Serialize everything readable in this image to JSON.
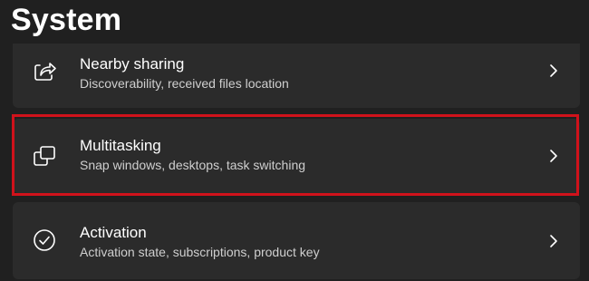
{
  "header": {
    "title": "System"
  },
  "settings": {
    "items": [
      {
        "title": "Nearby sharing",
        "subtitle": "Discoverability, received files location",
        "icon": "share-icon"
      },
      {
        "title": "Multitasking",
        "subtitle": "Snap windows, desktops, task switching",
        "icon": "multitasking-icon"
      },
      {
        "title": "Activation",
        "subtitle": "Activation state, subscriptions, product key",
        "icon": "check-circle-icon"
      }
    ]
  },
  "colors": {
    "background": "#202020",
    "card": "#2b2b2b",
    "highlight": "#d0121b"
  }
}
